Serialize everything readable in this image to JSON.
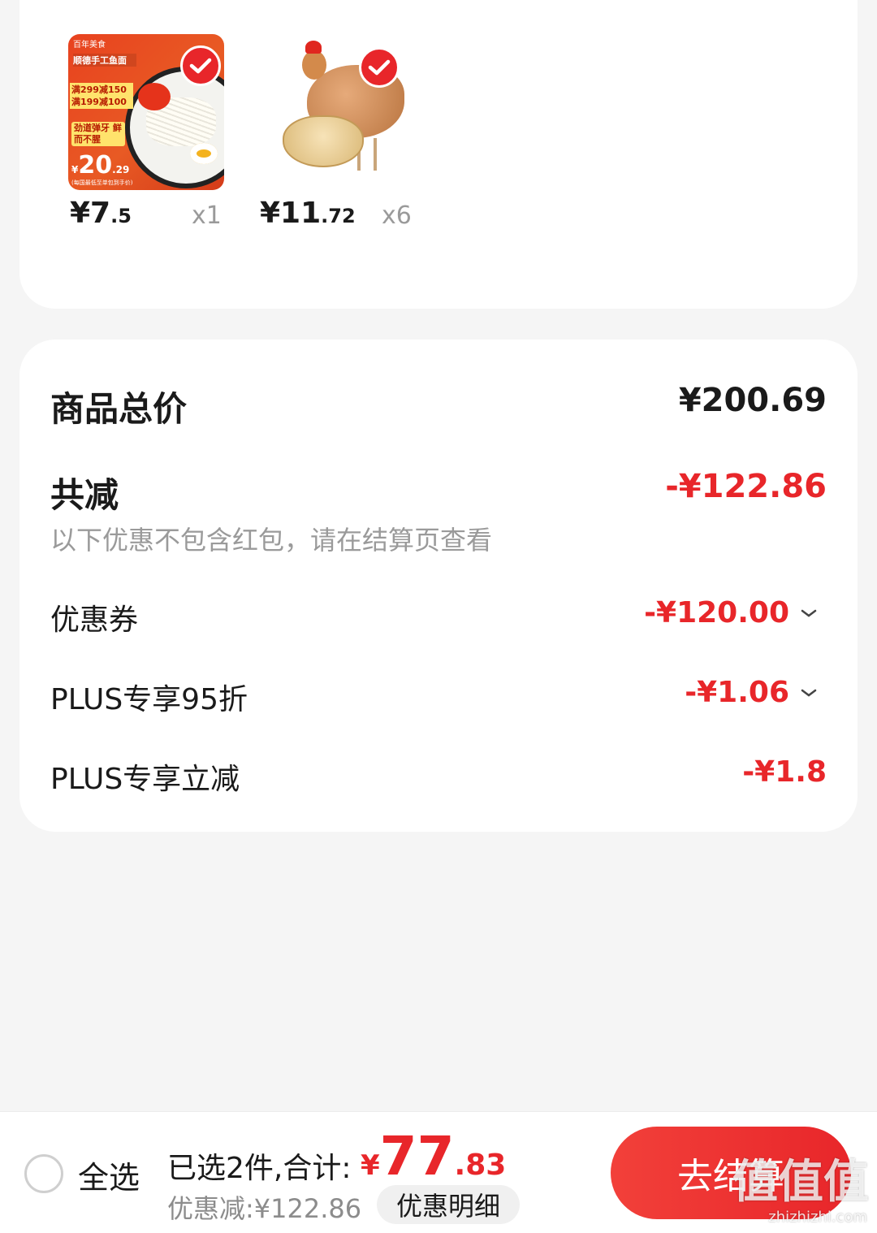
{
  "products": [
    {
      "price_int": "¥7",
      "price_dec": ".5",
      "qty": "x1",
      "thumb": {
        "tagline": "百年美食",
        "title": "顺德手工鱼面",
        "promo_1": "满299减150",
        "promo_2": "满199减100",
        "slogan": "劲道弹牙 鲜而不腥",
        "price_int": "20",
        "price_dec": ".29",
        "note": "(每国最低至单包到手价)"
      }
    },
    {
      "price_int": "¥11",
      "price_dec": ".72",
      "qty": "x6"
    }
  ],
  "summary": {
    "total_label": "商品总价",
    "total_value": "¥200.69",
    "discount_label": "共减",
    "discount_value": "-¥122.86",
    "hint": "以下优惠不包含红包，请在结算页查看",
    "lines": [
      {
        "label": "优惠券",
        "value": "-¥120.00",
        "expandable": true
      },
      {
        "label": "PLUS专享95折",
        "value": "-¥1.06",
        "expandable": true
      },
      {
        "label": "PLUS专享立减",
        "value": "-¥1.8",
        "expandable": false
      }
    ]
  },
  "bottom_bar": {
    "select_all_label": "全选",
    "selected_text": "已选2件,合计:",
    "total_currency": "¥",
    "total_int": "77",
    "total_dec": ".83",
    "saved_text": "优惠减:¥122.86",
    "detail_label": "优惠明细",
    "checkout_label": "去结算"
  },
  "watermark": {
    "text": "值值值",
    "url": "zhizhizhi.com"
  },
  "colors": {
    "accent": "#e8262a",
    "background": "#f5f5f5",
    "card": "#ffffff",
    "muted": "#9a9a9a"
  },
  "icons": [
    "check-icon",
    "chevron-down-icon",
    "radio-circle-icon"
  ]
}
